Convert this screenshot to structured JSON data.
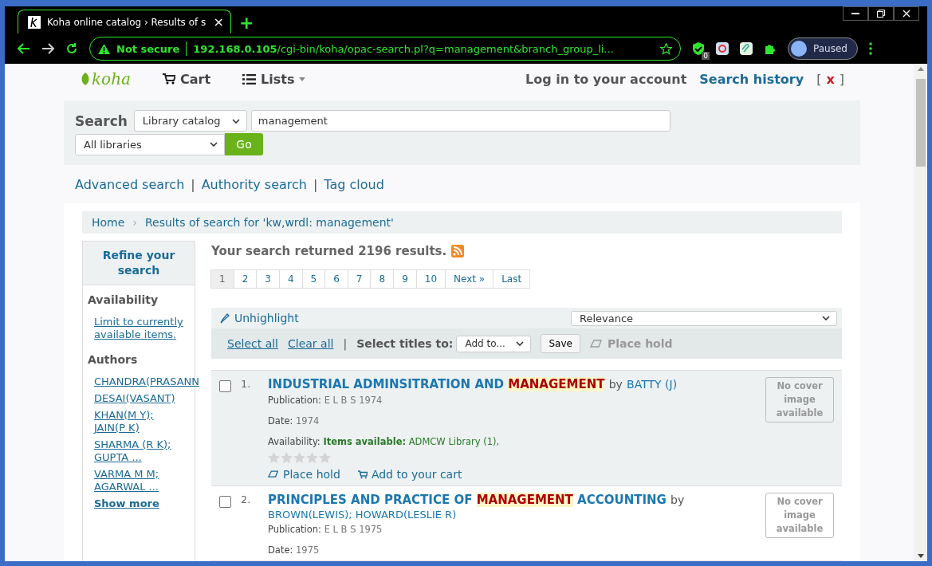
{
  "browser": {
    "tab_title": "Koha online catalog › Results of s",
    "tab_close": "×",
    "new_tab": "+",
    "security": "Not secure",
    "url_host": "192.168.0.105",
    "url_path": "/cgi-bin/koha/opac-search.pl?q=management&branch_group_li...",
    "extension_badge": "0",
    "profile": "Paused"
  },
  "nav": {
    "logo": "koha",
    "cart": "Cart",
    "lists": "Lists",
    "login": "Log in to your account",
    "search_history": "Search history",
    "bracket_open": "[",
    "clear_history": "x",
    "bracket_close": "]"
  },
  "search": {
    "label": "Search",
    "scope": "Library catalog",
    "query": "management",
    "library": "All libraries",
    "go": "Go"
  },
  "links": [
    "Advanced search",
    "Authority search",
    "Tag cloud"
  ],
  "link_separator": "|",
  "breadcrumb": {
    "items": [
      "Home",
      "Results of search for 'kw,wrdl: management'"
    ],
    "separator": "›"
  },
  "sidebar": {
    "title": "Refine your search",
    "facets": [
      {
        "heading": "Availability",
        "items": [
          "Limit to currently available items."
        ]
      },
      {
        "heading": "Authors",
        "items": [
          "CHANDRA(PRASANN",
          "DESAI(VASANT)",
          "KHAN(M Y); JAIN(P K)",
          "SHARMA (R K); GUPTA ...",
          "VARMA M M; AGARWAL ..."
        ],
        "more": "Show more"
      }
    ]
  },
  "results": {
    "summary": "Your search returned 2196 results.",
    "pages": [
      {
        "label": "1",
        "selected": true
      },
      {
        "label": "2",
        "selected": false
      },
      {
        "label": "3",
        "selected": false
      },
      {
        "label": "4",
        "selected": false
      },
      {
        "label": "5",
        "selected": false
      },
      {
        "label": "6",
        "selected": false
      },
      {
        "label": "7",
        "selected": false
      },
      {
        "label": "8",
        "selected": false
      },
      {
        "label": "9",
        "selected": false
      },
      {
        "label": "10",
        "selected": false
      },
      {
        "label": "Next »",
        "selected": false
      },
      {
        "label": "Last",
        "selected": false
      }
    ],
    "unhighlight": "Unhighlight",
    "sort": "Relevance",
    "select_all": "Select all",
    "clear_all": "Clear all",
    "separator": "|",
    "select_titles_label": "Select titles to:",
    "add_to": "Add to...",
    "save": "Save",
    "place_hold": "Place hold",
    "records": [
      {
        "number": "1.",
        "checked": false,
        "title": [
          {
            "text": "INDUSTRIAL ADMINSITRATION AND",
            "highlight": false
          },
          {
            "text": "MANAGEMENT",
            "highlight": true
          }
        ],
        "by": "by",
        "author": "BATTY (J)",
        "publication_label": "Publication:",
        "publication": "E L B S 1974",
        "date_label": "Date:",
        "date": "1974",
        "availability_label": "Availability:",
        "availability_status": "Items available:",
        "availability_detail": "ADMCW Library (1),",
        "stars": 0,
        "place_hold": "Place hold",
        "add_to_cart": "Add to your cart",
        "cover": "No cover image available"
      },
      {
        "number": "2.",
        "checked": false,
        "title": [
          {
            "text": "PRINCIPLES AND PRACTICE OF",
            "highlight": false
          },
          {
            "text": "MANAGEMENT",
            "highlight": true
          },
          {
            "text": "ACCOUNTING",
            "highlight": false
          }
        ],
        "by": "by",
        "author": "BROWN(LEWIS); HOWARD(LESLIE R)",
        "publication_label": "Publication:",
        "publication": "E L B S 1975",
        "date_label": "Date:",
        "date": "1975",
        "cover": "No cover image available"
      }
    ]
  }
}
